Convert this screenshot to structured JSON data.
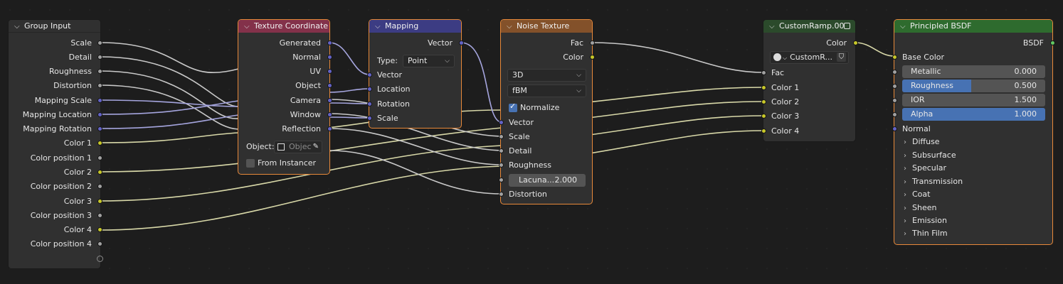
{
  "colors": {
    "background": "#1d1d1d",
    "node_body": "#303030",
    "group_header": "#303030",
    "texcoord_header": "#83314a",
    "mapping_header": "#3c3c83",
    "noise_header": "#83512a",
    "ramp_header": "#2b4a2b",
    "bsdf_header": "#2e6b2e",
    "selection": "#e8893a",
    "socket_gray": "#a1a1a1",
    "socket_vector": "#6363c7",
    "socket_color": "#c7c729",
    "socket_shader": "#63c763",
    "link_color": "#c9c9a5",
    "link_vector": "#9c9cd8",
    "slider_fill": "#4772b3"
  },
  "group_input": {
    "title": "Group Input",
    "outputs": [
      "Scale",
      "Detail",
      "Roughness",
      "Distortion",
      "Mapping Scale",
      "Mapping Location",
      "Mapping Rotation",
      "Color 1",
      "Color position 1",
      "Color 2",
      "Color position 2",
      "Color 3",
      "Color position 3",
      "Color 4",
      "Color position 4"
    ]
  },
  "texture_coordinate": {
    "title": "Texture Coordinate",
    "outputs": [
      "Generated",
      "Normal",
      "UV",
      "Object",
      "Camera",
      "Window",
      "Reflection"
    ],
    "object_label": "Object:",
    "object_placeholder": "Objec",
    "from_instancer": "From Instancer"
  },
  "mapping": {
    "title": "Mapping",
    "output": "Vector",
    "type_label": "Type:",
    "type_value": "Point",
    "inputs": [
      "Vector",
      "Location",
      "Rotation",
      "Scale"
    ]
  },
  "noise_texture": {
    "title": "Noise Texture",
    "outputs": [
      "Fac",
      "Color"
    ],
    "dimensions": "3D",
    "noise_type": "fBM",
    "normalize_label": "Normalize",
    "normalize_checked": true,
    "inputs": [
      "Vector",
      "Scale",
      "Detail",
      "Roughness"
    ],
    "lacunarity_label": "Lacuna...",
    "lacunarity_value": "2.000",
    "distortion": "Distortion"
  },
  "custom_ramp": {
    "title": "CustomRamp.00",
    "output": "Color",
    "datablock": "CustomR...",
    "inputs": [
      "Fac",
      "Color 1",
      "Color 2",
      "Color 3",
      "Color 4"
    ]
  },
  "principled_bsdf": {
    "title": "Principled BSDF",
    "output": "BSDF",
    "base_color": "Base Color",
    "metallic_label": "Metallic",
    "metallic_value": "0.000",
    "metallic_fraction": 0,
    "roughness_label": "Roughness",
    "roughness_value": "0.500",
    "roughness_fraction": 0.5,
    "ior_label": "IOR",
    "ior_value": "1.500",
    "ior_fraction": 0,
    "alpha_label": "Alpha",
    "alpha_value": "1.000",
    "alpha_fraction": 1,
    "normal": "Normal",
    "panels": [
      "Diffuse",
      "Subsurface",
      "Specular",
      "Transmission",
      "Coat",
      "Sheen",
      "Emission",
      "Thin Film"
    ]
  }
}
